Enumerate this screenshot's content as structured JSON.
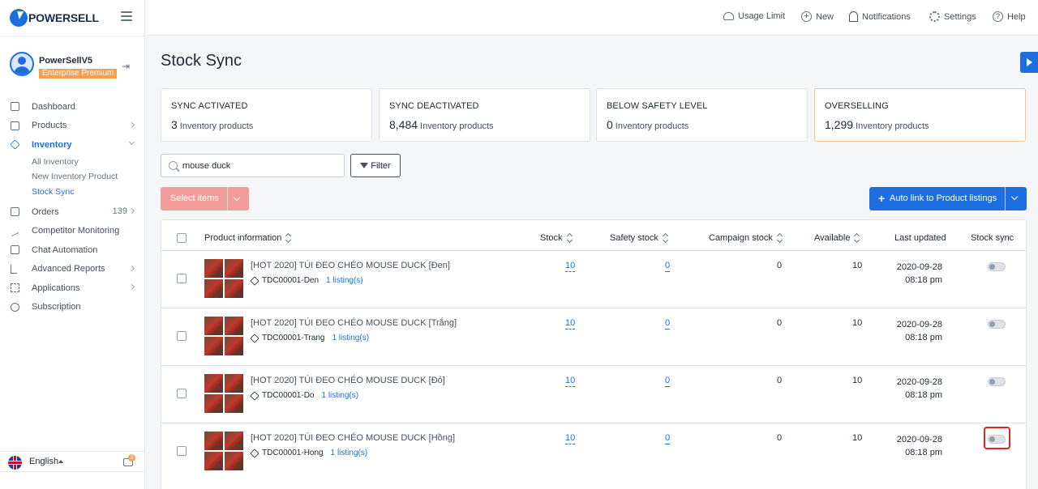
{
  "brand": {
    "name": "POWERSELL"
  },
  "profile": {
    "name": "PowerSellV5",
    "plan": "Enterprise Premium"
  },
  "nav": {
    "dashboard": "Dashboard",
    "products": "Products",
    "inventory": "Inventory",
    "inventory_sub": [
      "All Inventory",
      "New Inventory Product",
      "Stock Sync"
    ],
    "orders": "Orders",
    "orders_count": "139",
    "competitor": "Competitor Monitoring",
    "chat": "Chat Automation",
    "reports": "Advanced Reports",
    "applications": "Applications",
    "subscription": "Subscription"
  },
  "footer": {
    "language": "English",
    "chat_badge": "3"
  },
  "topbar": {
    "usage_limit": "Usage Limit",
    "new": "New",
    "notifications": "Notifications",
    "settings": "Settings",
    "help": "Help"
  },
  "page": {
    "title": "Stock Sync"
  },
  "cards": [
    {
      "title": "SYNC ACTIVATED",
      "value": "3",
      "unit": "Inventory products"
    },
    {
      "title": "SYNC DEACTIVATED",
      "value": "8,484",
      "unit": "Inventory products"
    },
    {
      "title": "BELOW SAFETY LEVEL",
      "value": "0",
      "unit": "Inventory products"
    },
    {
      "title": "OVERSELLING",
      "value": "1,299",
      "unit": "Inventory products"
    }
  ],
  "search": {
    "value": "mouse duck",
    "placeholder": ""
  },
  "filter_label": "Filter",
  "select_items_label": "Select items",
  "auto_link_label": "Auto link to Product listings",
  "table": {
    "headers": {
      "product": "Product information",
      "stock": "Stock",
      "safety": "Safety stock",
      "campaign": "Campaign stock",
      "available": "Available",
      "updated": "Last updated",
      "sync": "Stock sync"
    },
    "rows": [
      {
        "name": "[HOT 2020] TÚI ĐEO CHÉO MOUSE DUCK [Đen]",
        "sku": "TDC00001-Den",
        "listings": "1 listing(s)",
        "stock": "10",
        "safety": "0",
        "campaign": "0",
        "available": "10",
        "date": "2020-09-28",
        "time": "08:18 pm",
        "sync": false
      },
      {
        "name": "[HOT 2020] TÚI ĐEO CHÉO MOUSE DUCK [Trắng]",
        "sku": "TDC00001-Trang",
        "listings": "1 listing(s)",
        "stock": "10",
        "safety": "0",
        "campaign": "0",
        "available": "10",
        "date": "2020-09-28",
        "time": "08:18 pm",
        "sync": false
      },
      {
        "name": "[HOT 2020] TÚI ĐEO CHÉO MOUSE DUCK [Đỏ]",
        "sku": "TDC00001-Do",
        "listings": "1 listing(s)",
        "stock": "10",
        "safety": "0",
        "campaign": "0",
        "available": "10",
        "date": "2020-09-28",
        "time": "08:18 pm",
        "sync": false
      },
      {
        "name": "[HOT 2020] TÚI ĐEO CHÉO MOUSE DUCK [Hồng]",
        "sku": "TDC00001-Hong",
        "listings": "1 listing(s)",
        "stock": "10",
        "safety": "0",
        "campaign": "0",
        "available": "10",
        "date": "2020-09-28",
        "time": "08:18 pm",
        "sync": false
      }
    ]
  },
  "colors": {
    "primary": "#1d6fe0",
    "accent": "#f4a051",
    "highlight": "#e02424",
    "disabled_button": "#f29b9b"
  }
}
